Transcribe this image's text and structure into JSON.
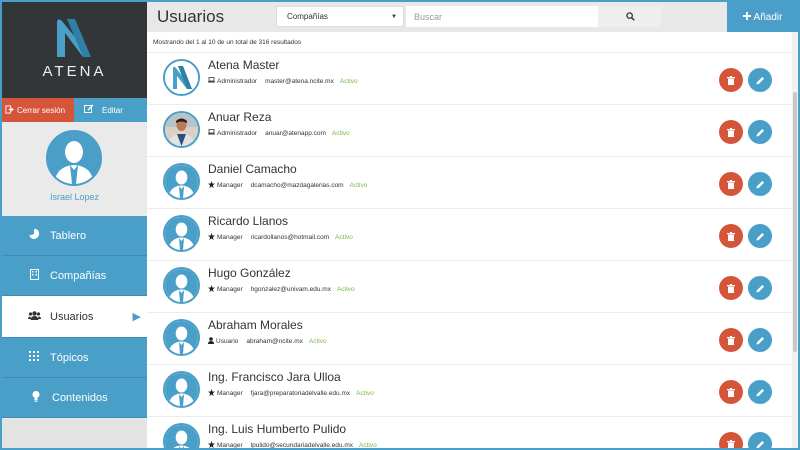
{
  "brand": {
    "name": "ATENA"
  },
  "sidebar": {
    "logout_label": "Cerrar sesión",
    "edit_label": "Editar",
    "user_name": "Israel Lopez",
    "nav": [
      {
        "label": "Tablero",
        "icon": "pie-chart-icon"
      },
      {
        "label": "Compañías",
        "icon": "building-icon"
      },
      {
        "label": "Usuarios",
        "icon": "users-icon",
        "active": true
      },
      {
        "label": "Tópicos",
        "icon": "grid-icon"
      },
      {
        "label": "Contenidos",
        "icon": "lightbulb-icon"
      }
    ]
  },
  "header": {
    "title": "Usuarios",
    "filter_value": "Compañías",
    "search_placeholder": "Buscar",
    "add_label": "Añadir"
  },
  "results_text": "Mostrando del 1 al 10 de un total de 316 resultados",
  "users": [
    {
      "name": "Atena Master",
      "role": "Administrador",
      "role_icon": "laptop-icon",
      "email": "master@atena.ncite.mx",
      "status": "Activo",
      "avatar": "atena-logo"
    },
    {
      "name": "Anuar Reza",
      "role": "Administrador",
      "role_icon": "laptop-icon",
      "email": "anuar@atenapp.com",
      "status": "Activo",
      "avatar": "photo"
    },
    {
      "name": "Daniel Camacho",
      "role": "Manager",
      "role_icon": "star-icon",
      "email": "dcamacho@mazdagalerias.com",
      "status": "Activo",
      "avatar": "silhouette"
    },
    {
      "name": "Ricardo Llanos",
      "role": "Manager",
      "role_icon": "star-icon",
      "email": "ricardollanos@hotmail.com",
      "status": "Activo",
      "avatar": "silhouette"
    },
    {
      "name": "Hugo González",
      "role": "Manager",
      "role_icon": "star-icon",
      "email": "hgonzalez@univam.edu.mx",
      "status": "Activo",
      "avatar": "silhouette"
    },
    {
      "name": "Abraham Morales",
      "role": "Usuario",
      "role_icon": "user-icon",
      "email": "abraham@ncite.mx",
      "status": "Activo",
      "avatar": "silhouette"
    },
    {
      "name": "Ing. Francisco Jara Ulloa",
      "role": "Manager",
      "role_icon": "star-icon",
      "email": "fjara@preparatoriadelvalle.edu.mx",
      "status": "Activo",
      "avatar": "silhouette"
    },
    {
      "name": "Ing. Luis Humberto Pulido",
      "role": "Manager",
      "role_icon": "star-icon",
      "email": "lpulido@secundariadelvalle.edu.mx",
      "status": "Activo",
      "avatar": "silhouette"
    }
  ],
  "colors": {
    "primary": "#4a9fc8",
    "danger": "#d5553b",
    "status_active": "#7ab648",
    "dark": "#323639"
  }
}
